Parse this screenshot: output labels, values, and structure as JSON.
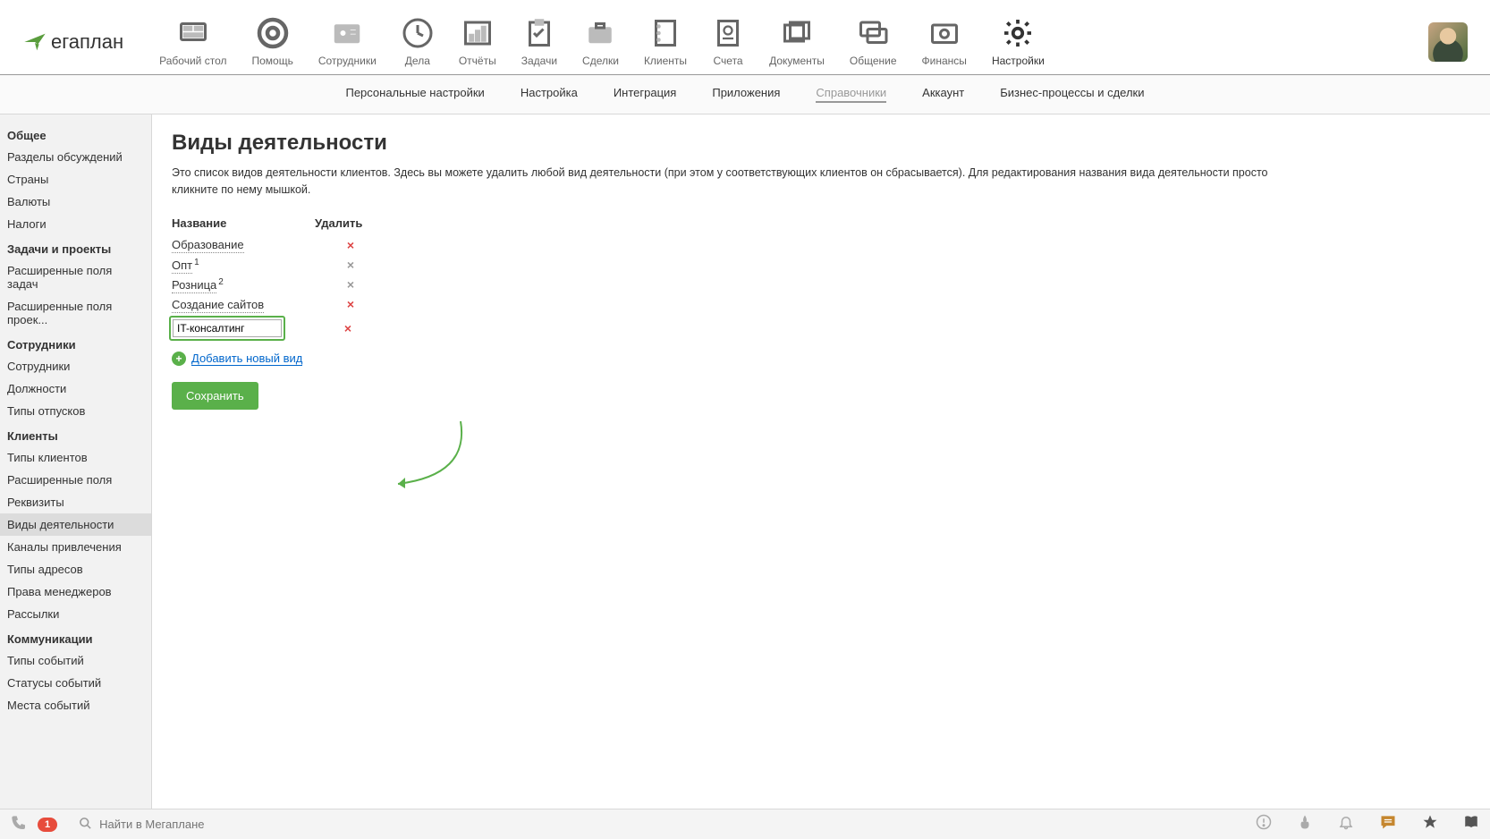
{
  "logo_text": "егаплан",
  "topnav": [
    {
      "label": "Рабочий стол",
      "icon": "desktop"
    },
    {
      "label": "Помощь",
      "icon": "help"
    },
    {
      "label": "Сотрудники",
      "icon": "employees"
    },
    {
      "label": "Дела",
      "icon": "clock"
    },
    {
      "label": "Отчёты",
      "icon": "reports"
    },
    {
      "label": "Задачи",
      "icon": "tasks"
    },
    {
      "label": "Сделки",
      "icon": "deals"
    },
    {
      "label": "Клиенты",
      "icon": "clients"
    },
    {
      "label": "Счета",
      "icon": "invoice"
    },
    {
      "label": "Документы",
      "icon": "documents"
    },
    {
      "label": "Общение",
      "icon": "chat"
    },
    {
      "label": "Финансы",
      "icon": "finance"
    },
    {
      "label": "Настройки",
      "icon": "settings",
      "active": true
    }
  ],
  "subnav": [
    {
      "label": "Персональные настройки"
    },
    {
      "label": "Настройка"
    },
    {
      "label": "Интеграция"
    },
    {
      "label": "Приложения"
    },
    {
      "label": "Справочники",
      "active": true
    },
    {
      "label": "Аккаунт"
    },
    {
      "label": "Бизнес-процессы и сделки"
    }
  ],
  "sidebar": [
    {
      "header": "Общее"
    },
    {
      "item": "Разделы обсуждений"
    },
    {
      "item": "Страны"
    },
    {
      "item": "Валюты"
    },
    {
      "item": "Налоги"
    },
    {
      "header": "Задачи и проекты"
    },
    {
      "item": "Расширенные поля задач"
    },
    {
      "item": "Расширенные поля проек..."
    },
    {
      "header": "Сотрудники"
    },
    {
      "item": "Сотрудники"
    },
    {
      "item": "Должности"
    },
    {
      "item": "Типы отпусков"
    },
    {
      "header": "Клиенты"
    },
    {
      "item": "Типы клиентов"
    },
    {
      "item": "Расширенные поля"
    },
    {
      "item": "Реквизиты"
    },
    {
      "item": "Виды деятельности",
      "active": true
    },
    {
      "item": "Каналы привлечения"
    },
    {
      "item": "Типы адресов"
    },
    {
      "item": "Права менеджеров"
    },
    {
      "item": "Рассылки"
    },
    {
      "header": "Коммуникации"
    },
    {
      "item": "Типы событий"
    },
    {
      "item": "Статусы событий"
    },
    {
      "item": "Места событий"
    }
  ],
  "page": {
    "title": "Виды деятельности",
    "description": "Это список видов деятельности клиентов. Здесь вы можете удалить любой вид деятельности (при этом у соответствующих клиентов он сбрасывается). Для редактирования названия вида деятельности просто кликните по нему мышкой.",
    "col_name": "Название",
    "col_delete": "Удалить",
    "rows": [
      {
        "name": "Образование",
        "sup": "",
        "red": true
      },
      {
        "name": "Опт",
        "sup": "1",
        "red": false
      },
      {
        "name": "Розница",
        "sup": "2",
        "red": false
      },
      {
        "name": "Создание сайтов",
        "sup": "",
        "red": true
      }
    ],
    "input_value": "IT-консалтинг",
    "add_label": "Добавить новый вид",
    "save_label": "Сохранить"
  },
  "bottombar": {
    "badge": "1",
    "search_placeholder": "Найти в Мегаплане"
  }
}
